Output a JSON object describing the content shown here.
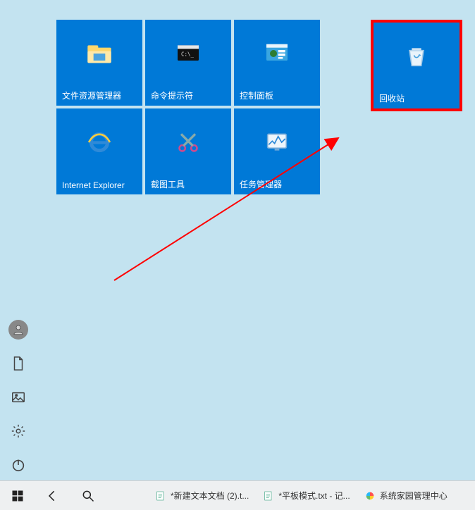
{
  "tiles": {
    "row1": [
      {
        "label": "文件资源管理器",
        "icon": "folder-icon"
      },
      {
        "label": "命令提示符",
        "icon": "cmd-icon"
      },
      {
        "label": "控制面板",
        "icon": "control-panel-icon"
      }
    ],
    "row2": [
      {
        "label": "Internet Explorer",
        "icon": "ie-icon"
      },
      {
        "label": "截图工具",
        "icon": "snip-icon"
      },
      {
        "label": "任务管理器",
        "icon": "taskmgr-icon"
      }
    ],
    "recycle": {
      "label": "回收站",
      "icon": "recycle-bin-icon"
    }
  },
  "rail": {
    "user": "user-icon",
    "document": "document-icon",
    "pictures": "pictures-icon",
    "settings": "settings-icon",
    "power": "power-icon"
  },
  "taskbar": {
    "start": "start-icon",
    "back": "back-icon",
    "search": "search-icon",
    "items": [
      {
        "label": "*新建文本文档 (2).t...",
        "icon": "notepad-icon"
      },
      {
        "label": "*平板模式.txt - 记...",
        "icon": "notepad-icon"
      },
      {
        "label": "系统家园管理中心",
        "icon": "colorwheel-icon"
      }
    ]
  }
}
